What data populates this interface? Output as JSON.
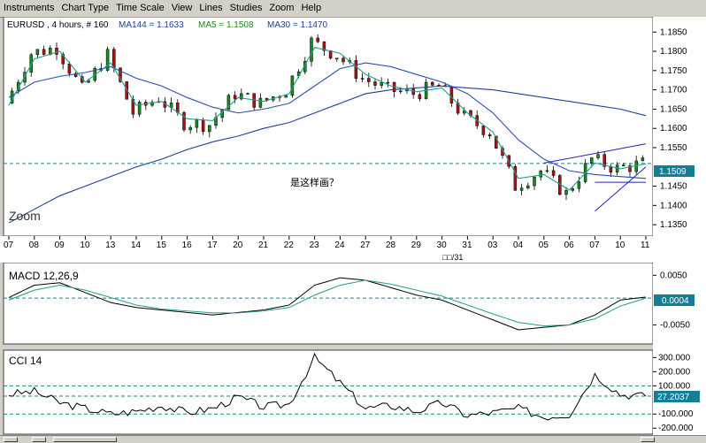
{
  "menu": [
    "Instruments",
    "Chart Type",
    "Time Scale",
    "View",
    "Lines",
    "Studies",
    "Zoom",
    "Help"
  ],
  "main": {
    "header_symbol": "EURUSD , 4 hours, # 160",
    "ma144_label": "MA144 = 1.1633",
    "ma5_label": "MA5 = 1.1508",
    "ma30_label": "MA30 = 1.1470",
    "zoom_label": "Zoom",
    "annotation": "是这样画？",
    "price_badge": "1.1509",
    "y_ticks": [
      "1.1850",
      "1.1800",
      "1.1750",
      "1.1700",
      "1.1650",
      "1.1600",
      "1.1550",
      "1.1450",
      "1.1400",
      "1.1350"
    ],
    "x_ticks": [
      "07",
      "08",
      "09",
      "10",
      "13",
      "14",
      "15",
      "16",
      "17",
      "20",
      "21",
      "22",
      "23",
      "24",
      "27",
      "28",
      "29",
      "30",
      "31",
      "03",
      "04",
      "05",
      "06",
      "07",
      "10",
      "11"
    ],
    "date_label": "□□/31"
  },
  "macd": {
    "title": "MACD 12,26,9",
    "ticks": [
      "0.0050",
      "-0.0050"
    ],
    "badge": "0.0004"
  },
  "cci": {
    "title": "CCI 14",
    "ticks": [
      "300.000",
      "200.000",
      "100.000",
      "-100.000",
      "-200.000"
    ],
    "badge": "27.2037"
  },
  "colors": {
    "bull": "#1a8a1a",
    "bear": "#b01010",
    "ma144": "#1f3f9a",
    "ma30": "#2a4fb0",
    "ma5": "#1ea090",
    "trend": "#2020c0",
    "dashed": "#118888",
    "badge": "#117f9a"
  },
  "chart_data": [
    {
      "type": "candlestick",
      "title": "EURUSD , 4 hours, # 160",
      "ylim": [
        1.1325,
        1.1885
      ],
      "x": [
        "07",
        "08",
        "09",
        "10",
        "13",
        "14",
        "15",
        "16",
        "17",
        "20",
        "21",
        "22",
        "23",
        "24",
        "27",
        "28",
        "29",
        "30",
        "31",
        "03",
        "04",
        "05",
        "06",
        "07",
        "10",
        "11"
      ],
      "close": [
        1.1665,
        1.1795,
        1.181,
        1.17,
        1.179,
        1.164,
        1.168,
        1.1615,
        1.161,
        1.169,
        1.1665,
        1.17,
        1.1825,
        1.179,
        1.173,
        1.17,
        1.169,
        1.171,
        1.163,
        1.159,
        1.145,
        1.149,
        1.143,
        1.152,
        1.1495,
        1.1509
      ],
      "series": [
        {
          "name": "MA144",
          "values": [
            1.1355,
            1.139,
            1.1425,
            1.145,
            1.1475,
            1.15,
            1.152,
            1.1545,
            1.1565,
            1.158,
            1.16,
            1.1615,
            1.164,
            1.1665,
            1.169,
            1.17,
            1.1705,
            1.171,
            1.1705,
            1.17,
            1.169,
            1.168,
            1.167,
            1.166,
            1.165,
            1.1633
          ]
        },
        {
          "name": "MA30",
          "values": [
            1.168,
            1.172,
            1.1735,
            1.1745,
            1.176,
            1.173,
            1.171,
            1.168,
            1.1655,
            1.164,
            1.165,
            1.1665,
            1.171,
            1.1755,
            1.177,
            1.176,
            1.174,
            1.172,
            1.169,
            1.164,
            1.157,
            1.152,
            1.149,
            1.148,
            1.1475,
            1.147
          ]
        },
        {
          "name": "MA5",
          "values": [
            1.166,
            1.178,
            1.18,
            1.172,
            1.177,
            1.166,
            1.167,
            1.1625,
            1.162,
            1.168,
            1.167,
            1.169,
            1.181,
            1.1795,
            1.174,
            1.171,
            1.1695,
            1.1705,
            1.164,
            1.159,
            1.147,
            1.148,
            1.144,
            1.151,
            1.1495,
            1.1508
          ]
        }
      ],
      "trendlines": [
        {
          "from": [
            "05",
            1.151
          ],
          "to": [
            "11",
            1.156
          ]
        },
        {
          "from": [
            "07",
            1.1385
          ],
          "to": [
            "11",
            1.15
          ]
        },
        {
          "from": [
            "07",
            1.146
          ],
          "to": [
            "11",
            1.146
          ]
        }
      ],
      "hline": 1.1509
    },
    {
      "type": "line",
      "title": "MACD 12,26,9",
      "ylim": [
        -0.0085,
        0.0072
      ],
      "x": [
        "07",
        "08",
        "09",
        "10",
        "13",
        "14",
        "15",
        "16",
        "17",
        "20",
        "21",
        "22",
        "23",
        "24",
        "27",
        "28",
        "29",
        "30",
        "31",
        "03",
        "04",
        "05",
        "06",
        "07",
        "10",
        "11"
      ],
      "series": [
        {
          "name": "MACD",
          "values": [
            0.0005,
            0.003,
            0.0035,
            0.0015,
            -0.0005,
            -0.0015,
            -0.002,
            -0.0025,
            -0.003,
            -0.0025,
            -0.002,
            -0.001,
            0.003,
            0.0045,
            0.004,
            0.0025,
            0.001,
            0.0,
            -0.002,
            -0.004,
            -0.006,
            -0.0055,
            -0.005,
            -0.003,
            0.0,
            0.0006
          ]
        },
        {
          "name": "Signal",
          "values": [
            0.0,
            0.002,
            0.003,
            0.002,
            0.0005,
            -0.001,
            -0.0018,
            -0.0022,
            -0.0026,
            -0.0026,
            -0.0022,
            -0.0015,
            0.001,
            0.003,
            0.004,
            0.0032,
            0.002,
            0.0008,
            -0.001,
            -0.0028,
            -0.0045,
            -0.0052,
            -0.005,
            -0.0038,
            -0.0012,
            0.0004
          ]
        }
      ],
      "hline": 0.0004
    },
    {
      "type": "line",
      "title": "CCI 14",
      "ylim": [
        -230,
        340
      ],
      "x": [
        "07",
        "08",
        "09",
        "10",
        "13",
        "14",
        "15",
        "16",
        "17",
        "20",
        "21",
        "22",
        "23",
        "24",
        "27",
        "28",
        "29",
        "30",
        "31",
        "03",
        "04",
        "05",
        "06",
        "07",
        "10",
        "11"
      ],
      "series": [
        {
          "name": "CCI 14",
          "values": [
            40,
            60,
            -20,
            -60,
            -100,
            -80,
            -40,
            -90,
            -60,
            20,
            -50,
            -30,
            300,
            120,
            -60,
            -40,
            -80,
            -20,
            -110,
            -90,
            -60,
            -120,
            -100,
            180,
            40,
            27
          ]
        }
      ],
      "hline": 27.2037
    }
  ]
}
